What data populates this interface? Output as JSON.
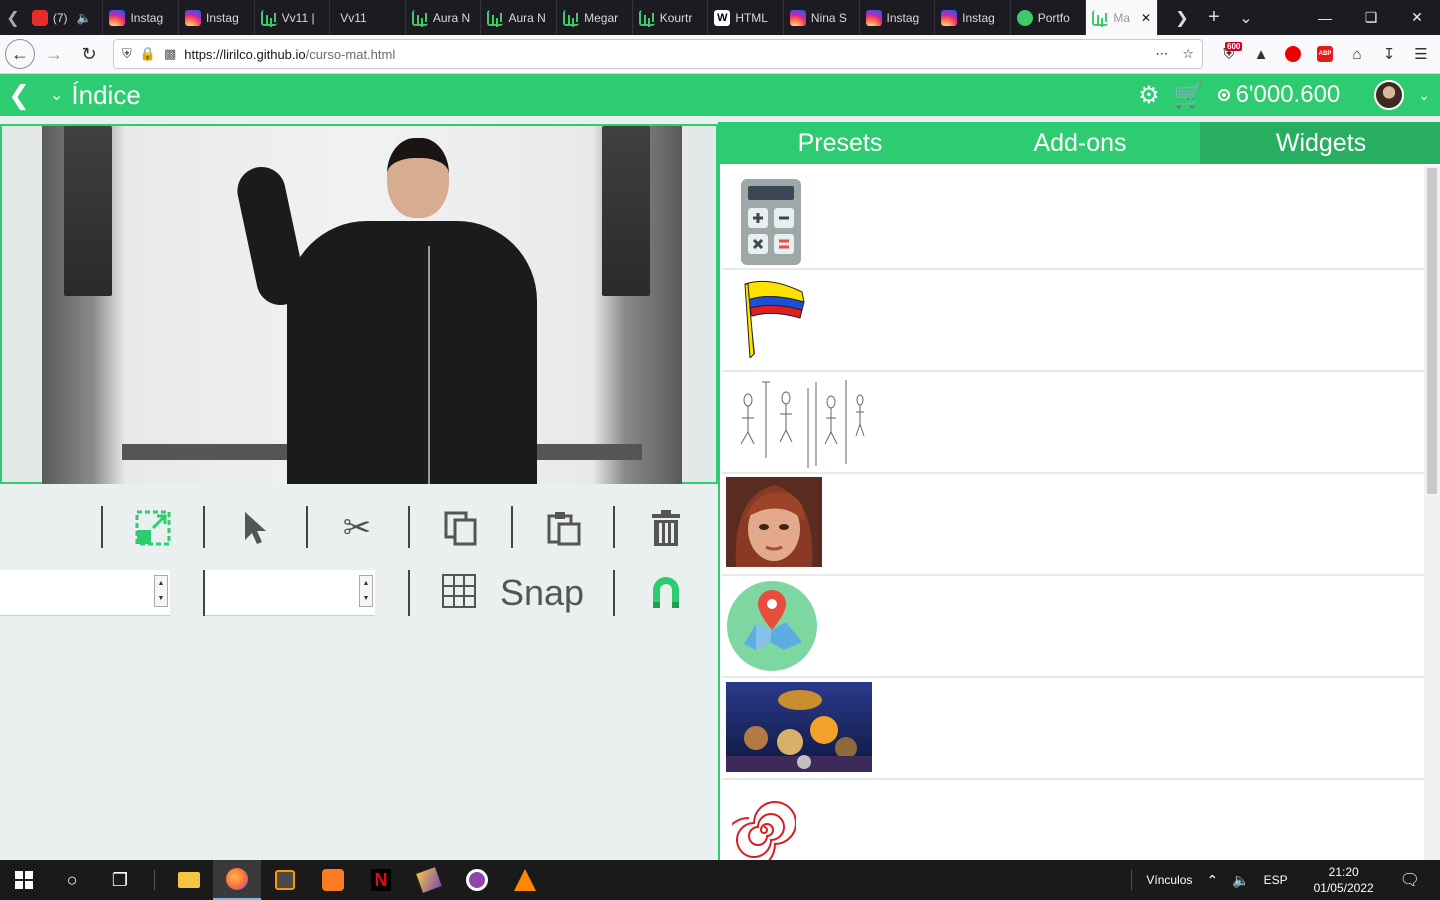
{
  "browser": {
    "tabs": [
      {
        "label": "(7)",
        "icon": "youtube-icon"
      },
      {
        "label": "Instag",
        "icon": "instagram-icon"
      },
      {
        "label": "Instag",
        "icon": "instagram-icon"
      },
      {
        "label": "Vv11 |",
        "icon": "bars-icon"
      },
      {
        "label": "Vv11",
        "icon": "none"
      },
      {
        "label": "Aura N",
        "icon": "bars-icon"
      },
      {
        "label": "Aura N",
        "icon": "bars-icon"
      },
      {
        "label": "Megar",
        "icon": "bars-icon"
      },
      {
        "label": "Kourtr",
        "icon": "bars-icon"
      },
      {
        "label": "HTML",
        "icon": "w-icon"
      },
      {
        "label": "Nina S",
        "icon": "instagram-icon"
      },
      {
        "label": "Instag",
        "icon": "instagram-icon"
      },
      {
        "label": "Instag",
        "icon": "instagram-icon"
      },
      {
        "label": "Portfo",
        "icon": "green-circle-icon"
      },
      {
        "label": "Ma",
        "icon": "bars-icon",
        "active": true
      }
    ],
    "url_host": "https://lirilco.github.io",
    "url_path": "/curso-mat.html",
    "ext_badge": "600",
    "abp_label": "ABP"
  },
  "app": {
    "title": "Índice",
    "coins": "6'000.600",
    "accent": "#2ecc71"
  },
  "toolbar": {
    "snap_label": "Snap"
  },
  "panel": {
    "tabs": [
      "Presets",
      "Add-ons",
      "Widgets"
    ],
    "active_tab": "Widgets",
    "widgets": [
      "calculator",
      "colombia-flag",
      "stick-figures-sketch",
      "girl-portrait",
      "map-pin",
      "band-artwork",
      "red-spiral"
    ]
  },
  "taskbar": {
    "links_label": "Vínculos",
    "lang": "ESP",
    "time": "21:20",
    "date": "01/05/2022"
  }
}
